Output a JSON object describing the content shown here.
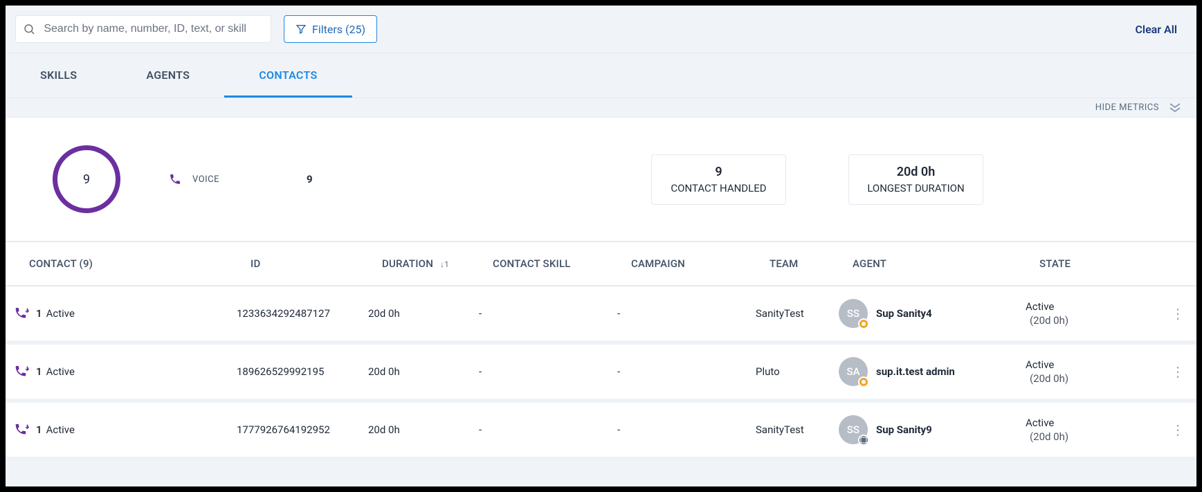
{
  "search": {
    "placeholder": "Search by name, number, ID, text, or skill"
  },
  "filters_label": "Filters (25)",
  "clear_all": "Clear All",
  "tabs": {
    "skills": "SKILLS",
    "agents": "AGENTS",
    "contacts": "CONTACTS"
  },
  "hide_metrics": "HIDE METRICS",
  "metrics": {
    "ring_total": "9",
    "voice_label": "VOICE",
    "voice_count": "9",
    "cards": [
      {
        "value": "9",
        "label": "CONTACT HANDLED"
      },
      {
        "value": "20d 0h",
        "label": "LONGEST DURATION"
      }
    ]
  },
  "columns": {
    "contact": "CONTACT (9)",
    "id": "ID",
    "duration": "DURATION",
    "duration_sort": "↓1",
    "skill": "CONTACT SKILL",
    "campaign": "CAMPAIGN",
    "team": "TEAM",
    "agent": "AGENT",
    "state": "STATE"
  },
  "rows": [
    {
      "count": "1",
      "status": "Active",
      "id": "1233634292487127",
      "duration": "20d 0h",
      "skill": "-",
      "campaign": "-",
      "team": "SanityTest",
      "avatar": "SS",
      "agent": "Sup Sanity4",
      "state": "Active",
      "state_sub": "(20d 0h)",
      "presence": "orange"
    },
    {
      "count": "1",
      "status": "Active",
      "id": "189626529992195",
      "duration": "20d 0h",
      "skill": "-",
      "campaign": "-",
      "team": "Pluto",
      "avatar": "SA",
      "agent": "sup.it.test admin",
      "state": "Active",
      "state_sub": "(20d 0h)",
      "presence": "orange"
    },
    {
      "count": "1",
      "status": "Active",
      "id": "1777926764192952",
      "duration": "20d 0h",
      "skill": "-",
      "campaign": "-",
      "team": "SanityTest",
      "avatar": "SS",
      "agent": "Sup Sanity9",
      "state": "Active",
      "state_sub": "(20d 0h)",
      "presence": "gray"
    }
  ]
}
